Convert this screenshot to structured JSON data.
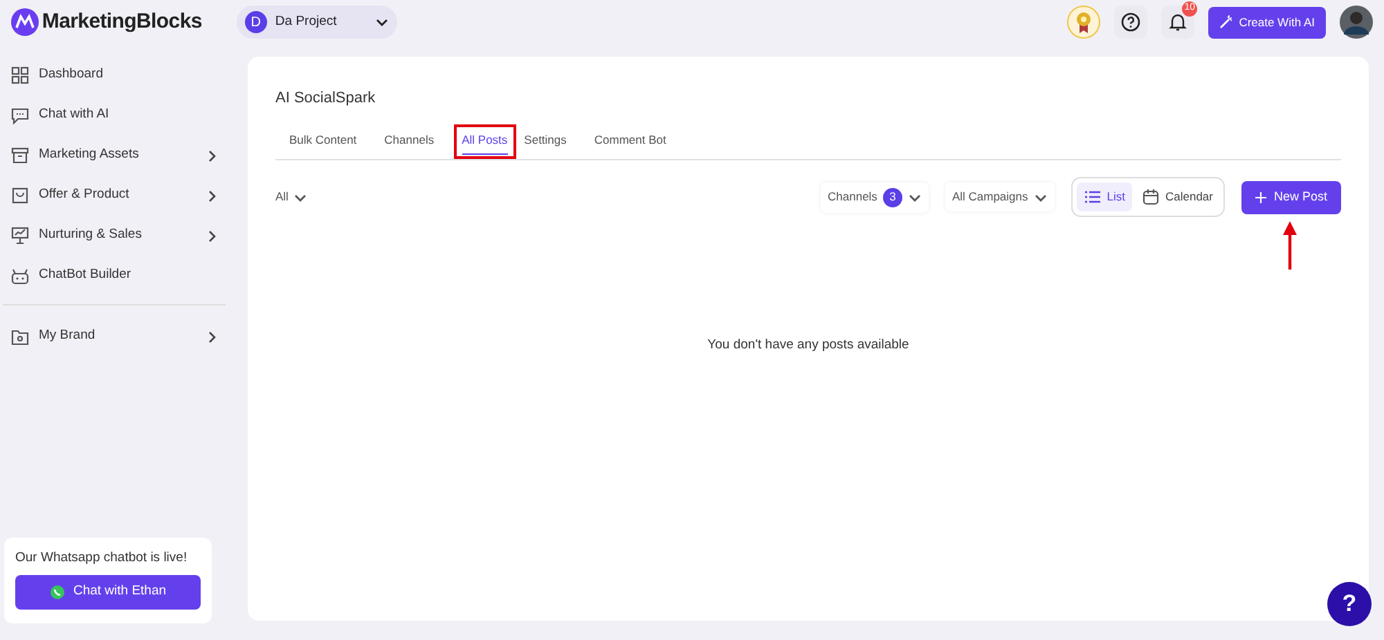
{
  "brand": {
    "name": "MarketingBlocks"
  },
  "project": {
    "initial": "D",
    "name": "Da Project"
  },
  "header": {
    "notification_count": "10",
    "create_button": "Create With AI"
  },
  "sidebar": {
    "groups": [
      [
        {
          "label": "Dashboard",
          "has_submenu": false
        },
        {
          "label": "Chat with AI",
          "has_submenu": false
        },
        {
          "label": "Marketing Assets",
          "has_submenu": true
        },
        {
          "label": "Offer & Product",
          "has_submenu": true
        },
        {
          "label": "Nurturing & Sales",
          "has_submenu": true
        },
        {
          "label": "ChatBot Builder",
          "has_submenu": false
        }
      ],
      [
        {
          "label": "My Brand",
          "has_submenu": true
        }
      ]
    ],
    "promo": {
      "text": "Our Whatsapp chatbot is live!",
      "button": "Chat with Ethan"
    }
  },
  "page": {
    "title": "AI SocialSpark",
    "tabs": [
      {
        "label": "Bulk Content",
        "selected": false,
        "highlighted": false
      },
      {
        "label": "Channels",
        "selected": false,
        "highlighted": false
      },
      {
        "label": "All Posts",
        "selected": true,
        "highlighted": true
      },
      {
        "label": "Settings",
        "selected": false,
        "highlighted": false
      },
      {
        "label": "Comment Bot",
        "selected": false,
        "highlighted": false
      }
    ],
    "filter": "All",
    "channels": {
      "label": "Channels",
      "count": "3"
    },
    "campaigns": "All Campaigns",
    "views": [
      {
        "label": "List",
        "selected": true
      },
      {
        "label": "Calendar",
        "selected": false
      }
    ],
    "new_post": {
      "label": "New Post",
      "annotated": true
    },
    "empty_message": "You don't have any posts available"
  },
  "help_button": "?"
}
